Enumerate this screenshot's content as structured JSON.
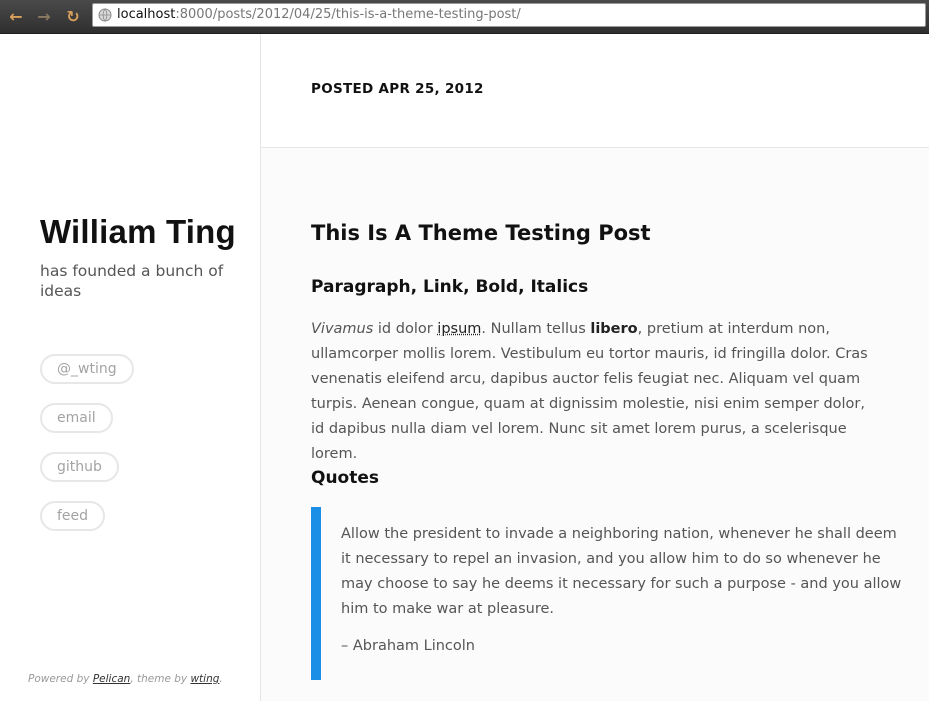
{
  "browser": {
    "url_host": "localhost",
    "url_rest": ":8000/posts/2012/04/25/this-is-a-theme-testing-post/",
    "icons": {
      "back": "arrow-left-icon",
      "forward": "arrow-right-icon",
      "reload": "reload-icon",
      "site": "globe-icon"
    }
  },
  "sidebar": {
    "title": "William Ting",
    "tagline": "has founded a bunch of ideas",
    "links": [
      "@_wting",
      "email",
      "github",
      "feed"
    ],
    "footer": {
      "prefix": "Powered by ",
      "pelican": "Pelican",
      "middle": ", theme by ",
      "wting": "wting",
      "suffix": "."
    }
  },
  "post": {
    "posted": "POSTED APR 25, 2012",
    "title": "This Is A Theme Testing Post",
    "section1_heading": "Paragraph, Link, Bold, Italics",
    "p_italic": "Vivamus",
    "p_text1": " id dolor ",
    "p_link": "ipsum",
    "p_text2": ". Nullam tellus ",
    "p_bold": "libero",
    "p_text3": ", pretium at interdum non, ullamcorper mollis lorem. Vestibulum eu tortor mauris, id fringilla dolor. Cras venenatis eleifend arcu, dapibus auctor felis feugiat nec. Aliquam vel quam turpis. Aenean congue, quam at dignissim molestie, nisi enim semper dolor, id dapibus nulla diam vel lorem. Nunc sit amet lorem purus, a scelerisque lorem.",
    "section2_heading": "Quotes",
    "quote": "Allow the president to invade a neighboring nation, whenever he shall deem it necessary to repel an invasion, and you allow him to do so whenever he may choose to say he deems it necessary for such a purpose - and you allow him to make war at pleasure.",
    "quote_cite": "– Abraham Lincoln"
  },
  "colors": {
    "accent": "#1b8fe6",
    "title": "#111111",
    "body_text": "#555555",
    "pill_border": "#e7e7e7",
    "pill_text": "#a3a3a3"
  }
}
